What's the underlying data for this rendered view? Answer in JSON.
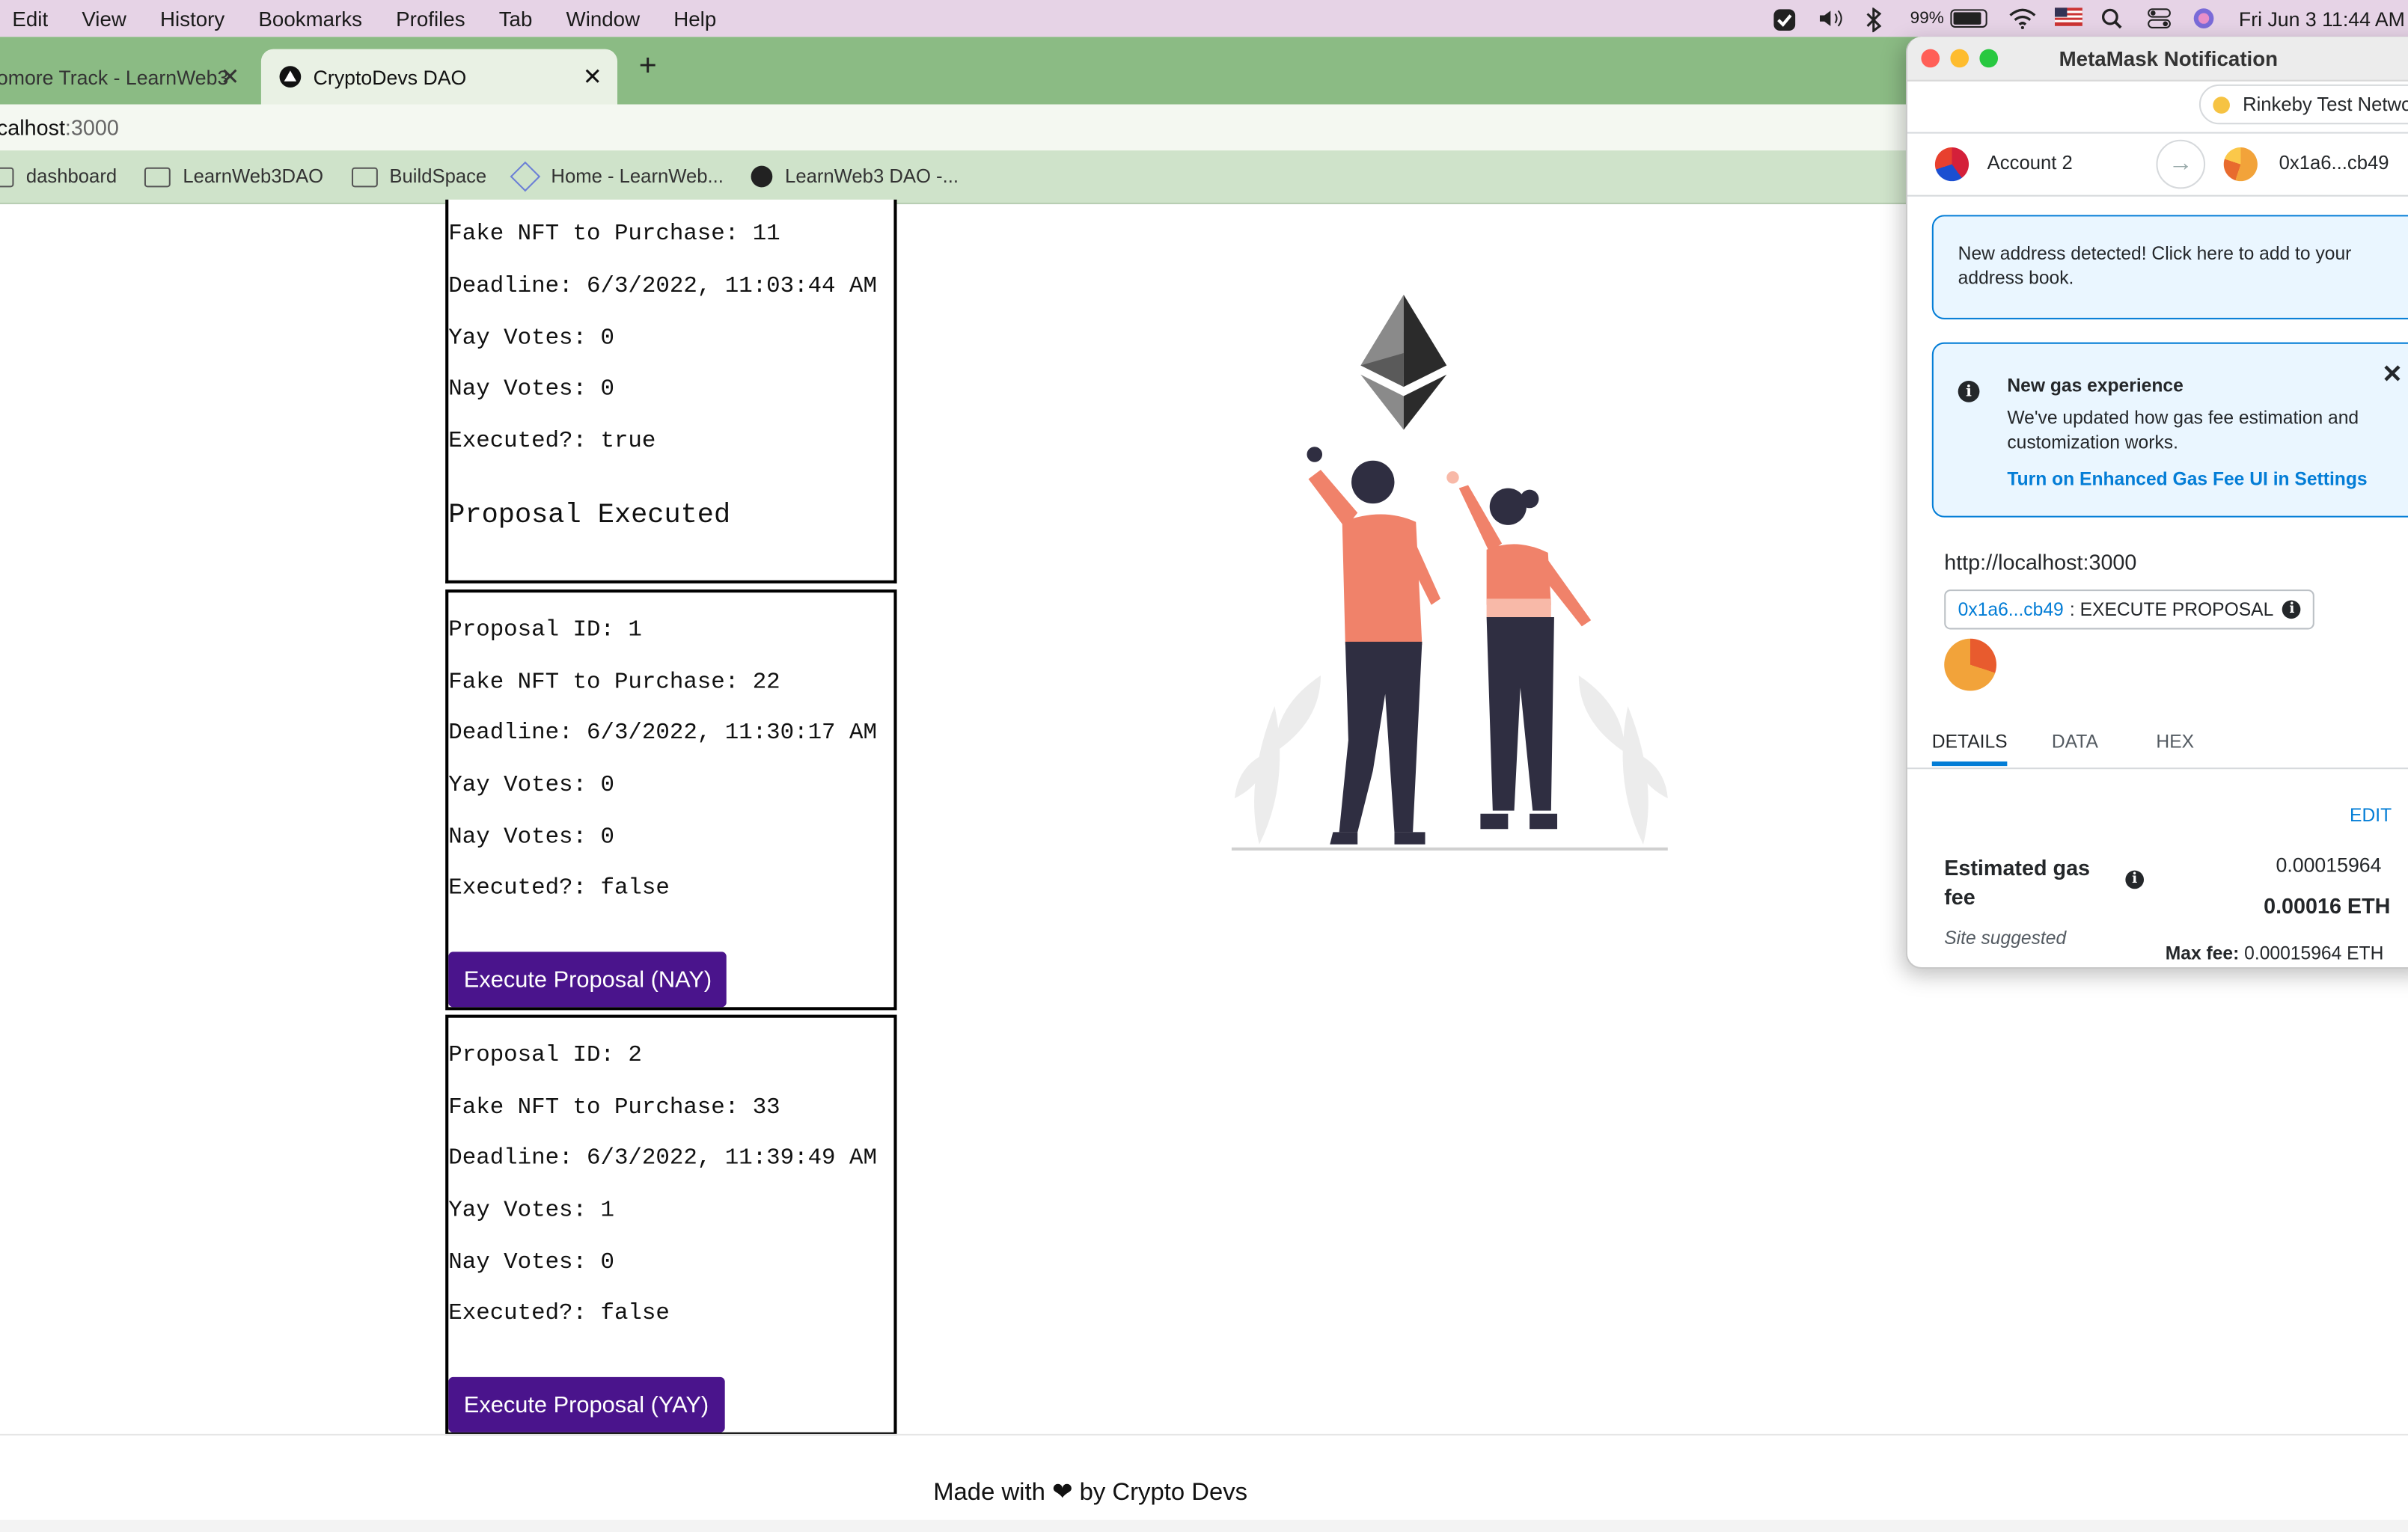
{
  "menubar": {
    "items": [
      "Edit",
      "View",
      "History",
      "Bookmarks",
      "Profiles",
      "Tab",
      "Window",
      "Help"
    ],
    "battery": "99%",
    "datetime": "Fri Jun 3  11:44 AM"
  },
  "browser": {
    "tabs": [
      {
        "title": "omore Track - LearnWeb3"
      },
      {
        "title": "CryptoDevs DAO"
      }
    ],
    "url_host": "calhost",
    "url_port": ":3000",
    "bookmarks": [
      "dashboard",
      "LearnWeb3DAO",
      "BuildSpace",
      "Home - LearnWeb...",
      "LearnWeb3 DAO -..."
    ]
  },
  "proposals": [
    {
      "nft": "Fake NFT to Purchase: 11",
      "deadline": "Deadline: 6/3/2022, 11:03:44 AM",
      "yay": "Yay Votes: 0",
      "nay": "Nay Votes: 0",
      "executed": "Executed?: true",
      "status": "Proposal Executed"
    },
    {
      "id": "Proposal ID: 1",
      "nft": "Fake NFT to Purchase: 22",
      "deadline": "Deadline: 6/3/2022, 11:30:17 AM",
      "yay": "Yay Votes: 0",
      "nay": "Nay Votes: 0",
      "executed": "Executed?: false",
      "button": "Execute Proposal (NAY)"
    },
    {
      "id": "Proposal ID: 2",
      "nft": "Fake NFT to Purchase: 33",
      "deadline": "Deadline: 6/3/2022, 11:39:49 AM",
      "yay": "Yay Votes: 1",
      "nay": "Nay Votes: 0",
      "executed": "Executed?: false",
      "button": "Execute Proposal (YAY)"
    }
  ],
  "footer": "Made with ❤ by Crypto Devs",
  "metamask": {
    "window_title": "MetaMask Notification",
    "network": "Rinkeby Test Network",
    "from_account": "Account 2",
    "to_address": "0x1a6...cb49",
    "address_notice": "New address detected! Click here to add to your address book.",
    "gas_title": "New gas experience",
    "gas_body": "We've updated how gas fee estimation and customization works.",
    "gas_link": "Turn on Enhanced Gas Fee UI in Settings",
    "origin": "http://localhost:3000",
    "chip_address": "0x1a6...cb49",
    "chip_method": ": EXECUTE PROPOSAL",
    "tabs": [
      "DETAILS",
      "DATA",
      "HEX"
    ],
    "edit": "EDIT",
    "gas_label": "Estimated gas fee",
    "gas_value": "0.00015964",
    "gas_eth": "0.00016 ETH",
    "site_suggested": "Site suggested",
    "max_fee_label": "Max fee:",
    "max_fee_value": "0.00015964 ETH"
  },
  "colors": {
    "button_purple": "#4a148c",
    "tabbar_green": "#8bbb84",
    "metamask_blue": "#037dd6",
    "illustration_orange": "#f0826a",
    "illustration_dark": "#2f2e41"
  }
}
